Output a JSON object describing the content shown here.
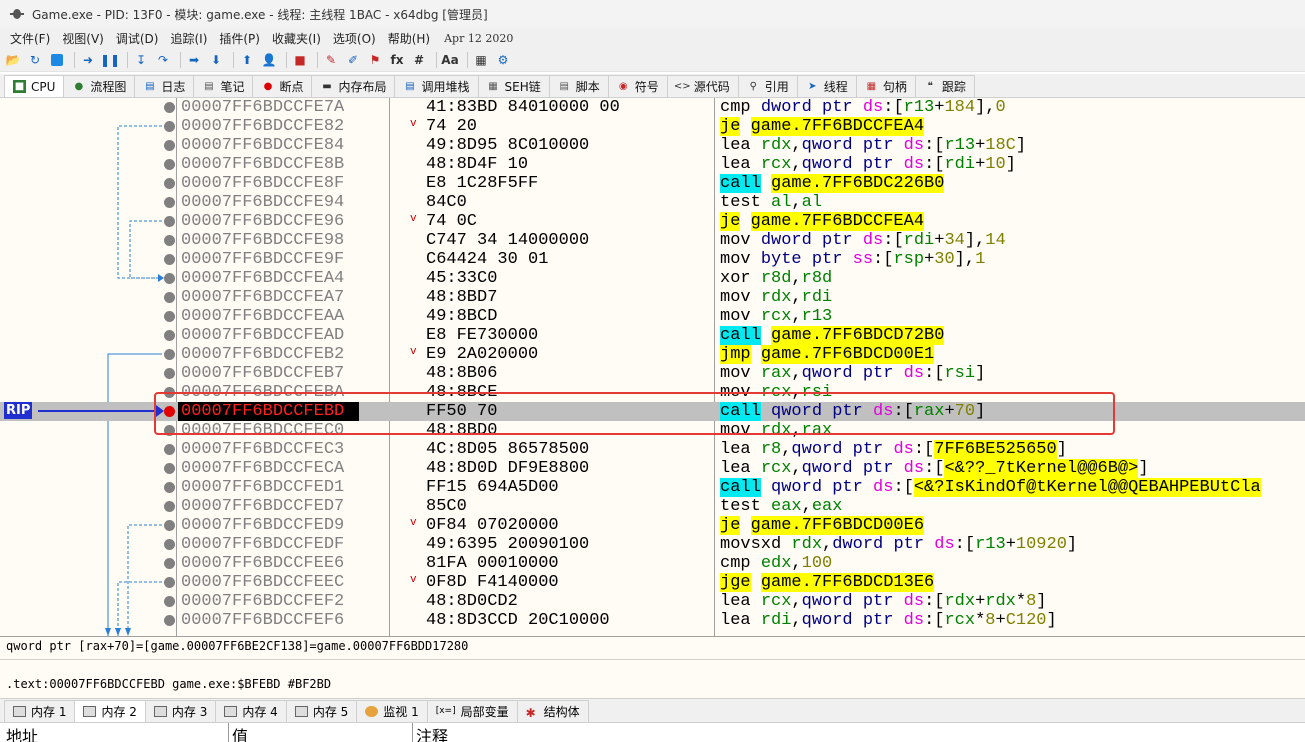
{
  "window": {
    "title": "Game.exe - PID: 13F0 - 模块: game.exe - 线程: 主线程 1BAC - x64dbg [管理员]"
  },
  "menu": {
    "items": [
      "文件(F)",
      "视图(V)",
      "调试(D)",
      "追踪(I)",
      "插件(P)",
      "收藏夹(I)",
      "选项(O)",
      "帮助(H)"
    ],
    "date": "Apr 12 2020"
  },
  "toolbar": {
    "icons": [
      "open-icon",
      "restart-icon",
      "stop-icon",
      "run-icon",
      "pause-icon",
      "step-into-icon",
      "step-over-icon",
      "trace-into-icon",
      "trace-over-icon",
      "execute-till-return-icon",
      "run-to-user-code-icon",
      "script-icon",
      "comment-icon",
      "label-icon",
      "bookmark-icon",
      "function-icon",
      "hash-icon",
      "font-icon",
      "calculator-icon",
      "settings-icon"
    ],
    "labels": {
      "fx": "fx",
      "hash": "#",
      "font": "Aa"
    }
  },
  "tabs": [
    {
      "label": "CPU",
      "icon": "cpu-icon",
      "active": true
    },
    {
      "label": "流程图",
      "icon": "graph-icon"
    },
    {
      "label": "日志",
      "icon": "log-icon"
    },
    {
      "label": "笔记",
      "icon": "notes-icon"
    },
    {
      "label": "断点",
      "icon": "breakpoint-icon"
    },
    {
      "label": "内存布局",
      "icon": "memory-map-icon"
    },
    {
      "label": "调用堆栈",
      "icon": "call-stack-icon"
    },
    {
      "label": "SEH链",
      "icon": "seh-icon"
    },
    {
      "label": "脚本",
      "icon": "script-icon"
    },
    {
      "label": "符号",
      "icon": "symbols-icon"
    },
    {
      "label": "源代码",
      "icon": "source-icon"
    },
    {
      "label": "引用",
      "icon": "references-icon"
    },
    {
      "label": "线程",
      "icon": "threads-icon"
    },
    {
      "label": "句柄",
      "icon": "handles-icon"
    },
    {
      "label": "跟踪",
      "icon": "trace-icon"
    }
  ],
  "disasm": {
    "rip_label": "RIP",
    "rows": [
      {
        "addr": "00007FF6BDCCFE7A",
        "bytes": "41:83BD 84010000 00",
        "jmark": ""
      },
      {
        "addr": "00007FF6BDCCFE82",
        "bytes": "74 20",
        "jmark": "v"
      },
      {
        "addr": "00007FF6BDCCFE84",
        "bytes": "49:8D95 8C010000",
        "jmark": ""
      },
      {
        "addr": "00007FF6BDCCFE8B",
        "bytes": "48:8D4F 10",
        "jmark": ""
      },
      {
        "addr": "00007FF6BDCCFE8F",
        "bytes": "E8 1C28F5FF",
        "jmark": ""
      },
      {
        "addr": "00007FF6BDCCFE94",
        "bytes": "84C0",
        "jmark": ""
      },
      {
        "addr": "00007FF6BDCCFE96",
        "bytes": "74 0C",
        "jmark": "v"
      },
      {
        "addr": "00007FF6BDCCFE98",
        "bytes": "C747 34 14000000",
        "jmark": ""
      },
      {
        "addr": "00007FF6BDCCFE9F",
        "bytes": "C64424 30 01",
        "jmark": ""
      },
      {
        "addr": "00007FF6BDCCFEA4",
        "bytes": "45:33C0",
        "jmark": ""
      },
      {
        "addr": "00007FF6BDCCFEA7",
        "bytes": "48:8BD7",
        "jmark": ""
      },
      {
        "addr": "00007FF6BDCCFEAA",
        "bytes": "49:8BCD",
        "jmark": ""
      },
      {
        "addr": "00007FF6BDCCFEAD",
        "bytes": "E8 FE730000",
        "jmark": ""
      },
      {
        "addr": "00007FF6BDCCFEB2",
        "bytes": "E9 2A020000",
        "jmark": "v"
      },
      {
        "addr": "00007FF6BDCCFEB7",
        "bytes": "48:8B06",
        "jmark": ""
      },
      {
        "addr": "00007FF6BDCCFEBA",
        "bytes": "48:8BCE",
        "jmark": ""
      },
      {
        "addr": "00007FF6BDCCFEBD",
        "bytes": "FF50 70",
        "jmark": "",
        "rip": true
      },
      {
        "addr": "00007FF6BDCCFEC0",
        "bytes": "48:8BD0",
        "jmark": ""
      },
      {
        "addr": "00007FF6BDCCFEC3",
        "bytes": "4C:8D05 86578500",
        "jmark": ""
      },
      {
        "addr": "00007FF6BDCCFECA",
        "bytes": "48:8D0D DF9E8800",
        "jmark": ""
      },
      {
        "addr": "00007FF6BDCCFED1",
        "bytes": "FF15 694A5D00",
        "jmark": ""
      },
      {
        "addr": "00007FF6BDCCFED7",
        "bytes": "85C0",
        "jmark": ""
      },
      {
        "addr": "00007FF6BDCCFED9",
        "bytes": "0F84 07020000",
        "jmark": "v"
      },
      {
        "addr": "00007FF6BDCCFEDF",
        "bytes": "49:6395 20090100",
        "jmark": ""
      },
      {
        "addr": "00007FF6BDCCFEE6",
        "bytes": "81FA 00010000",
        "jmark": ""
      },
      {
        "addr": "00007FF6BDCCFEEC",
        "bytes": "0F8D F4140000",
        "jmark": "v"
      },
      {
        "addr": "00007FF6BDCCFEF2",
        "bytes": "48:8D0CD2",
        "jmark": ""
      },
      {
        "addr": "00007FF6BDCCFEF6",
        "bytes": "48:8D3CCD 20C10000",
        "jmark": ""
      }
    ],
    "instr_text": [
      "cmp dword ptr ds:[r13+184],0",
      "je game.7FF6BDCCFEA4",
      "lea rdx,qword ptr ds:[r13+18C]",
      "lea rcx,qword ptr ds:[rdi+10]",
      "call game.7FF6BDC226B0",
      "test al,al",
      "je game.7FF6BDCCFEA4",
      "mov dword ptr ds:[rdi+34],14",
      "mov byte ptr ss:[rsp+30],1",
      "xor r8d,r8d",
      "mov rdx,rdi",
      "mov rcx,r13",
      "call game.7FF6BDCD72B0",
      "jmp game.7FF6BDCD00E1",
      "mov rax,qword ptr ds:[rsi]",
      "mov rcx,rsi",
      "call qword ptr ds:[rax+70]",
      "mov rdx,rax",
      "lea r8,qword ptr ds:[7FF6BE525650]",
      "lea rcx,qword ptr ds:[<&??_7tKernel@@6B@>]",
      "call qword ptr ds:[<&?IsKindOf@tKernel@@QEBAHPEBUtCla",
      "test eax,eax",
      "je game.7FF6BDCD00E6",
      "movsxd rdx,dword ptr ds:[r13+10920]",
      "cmp edx,100",
      "jge game.7FF6BDCD13E6",
      "lea rcx,qword ptr ds:[rdx+rdx*8]",
      "lea rdi,qword ptr ds:[rcx*8+C120]"
    ]
  },
  "info": {
    "line1": "qword ptr [rax+70]=[game.00007FF6BE2CF138]=game.00007FF6BDD17280",
    "line2": ".text:00007FF6BDCCFEBD game.exe:$BFEBD #BF2BD"
  },
  "memtabs": [
    {
      "label": "内存 1"
    },
    {
      "label": "内存 2",
      "active": true
    },
    {
      "label": "内存 3"
    },
    {
      "label": "内存 4"
    },
    {
      "label": "内存 5"
    },
    {
      "label": "监视 1",
      "icon": "watch-icon"
    },
    {
      "label": "局部变量",
      "icon": "locals-icon"
    },
    {
      "label": "结构体",
      "icon": "struct-icon"
    }
  ],
  "dump": {
    "col_address": "地址",
    "col_value": "值",
    "col_comment": "注释"
  }
}
